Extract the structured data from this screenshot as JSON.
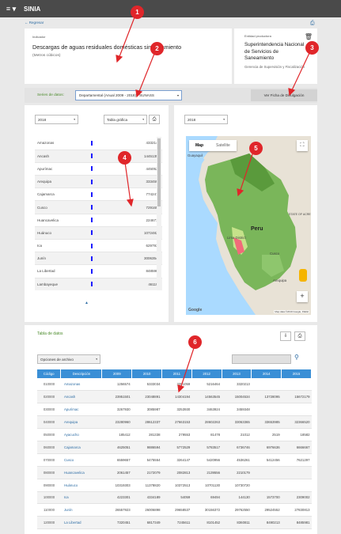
{
  "app": {
    "title": "SINIA",
    "menu_icon": "hamburger-icon"
  },
  "nav": {
    "back": "← Regresar"
  },
  "indicator": {
    "label": "Indicador",
    "title": "Descargas de aguas residuales domésticas sin tratamiento",
    "unit": "(Metros cúbicos)"
  },
  "entity": {
    "label": "Entidad productora",
    "name": "Superintendencia Nacional de Servicios de Saneamiento",
    "sub": "Gerencia de Supervisión y Fiscalización"
  },
  "series": {
    "label": "Series de datos:",
    "selected": "Departamental (Anual 2009 - 2018) - SUNASS",
    "ficha_button": "Ver Ficha de Divulgación"
  },
  "chart_panel": {
    "year": "2018",
    "view": "Tabla gráfica",
    "rows": [
      {
        "name": "Amazonas",
        "value": "4332143"
      },
      {
        "name": "Ancash",
        "value": "14451351"
      },
      {
        "name": "Apurímac",
        "value": "4450526"
      },
      {
        "name": "Arequipa",
        "value": "3334596"
      },
      {
        "name": "Cajamarca",
        "value": "7742474"
      },
      {
        "name": "Cusco",
        "value": "7291657"
      },
      {
        "name": "Huancavelica",
        "value": "2246713"
      },
      {
        "name": "Huánuco",
        "value": "10724820"
      },
      {
        "name": "Ica",
        "value": "6297930"
      },
      {
        "name": "Junín",
        "value": "30063548"
      },
      {
        "name": "La Libertad",
        "value": "8485981"
      },
      {
        "name": "Lambayeque",
        "value": "461193"
      }
    ]
  },
  "map_panel": {
    "year": "2018",
    "tab_map": "Map",
    "tab_satellite": "Satellite",
    "labels": {
      "guayaquil": "Guayaquil",
      "peru": "Peru",
      "lima": "Lima District",
      "acre": "STATE OF ACRE",
      "cusco": "Cusco",
      "arequipa": "Arequipa"
    },
    "google": "Google",
    "attribution": "Map data ©2019 Google, INEGI"
  },
  "data_table": {
    "title": "Tabla de datos",
    "options": "Opciones de archivo",
    "headers": [
      "Código",
      "Descripción",
      "2009",
      "2010",
      "2011",
      "2012",
      "2013",
      "2014",
      "2015"
    ],
    "rows": [
      [
        "010000",
        "Amazonas",
        "1256574",
        "5333034",
        "3391059",
        "5216464",
        "3320213",
        "",
        ""
      ],
      [
        "020000",
        "Ancash",
        "23951501",
        "23048891",
        "14304194",
        "14563545",
        "15004534",
        "13728095",
        "15672179"
      ],
      [
        "030000",
        "Apurímac",
        "3267930",
        "3085987",
        "3253930",
        "3463924",
        "3459348",
        "",
        ""
      ],
      [
        "040000",
        "Arequipa",
        "23280960",
        "28612337",
        "27663153",
        "28602263",
        "33063365",
        "33653985",
        "32366520"
      ],
      [
        "050000",
        "Ayacucho",
        "185412",
        "281338",
        "279553",
        "81478",
        "21012",
        "2519",
        "18582"
      ],
      [
        "060000",
        "Cajamarca",
        "4625051",
        "9886594",
        "5772529",
        "5783517",
        "6736746",
        "6976636",
        "6666667"
      ],
      [
        "070000",
        "Cusco",
        "6559657",
        "5475554",
        "3264147",
        "5420956",
        "4536261",
        "5412456",
        "7621297"
      ],
      [
        "080000",
        "Huancavelica",
        "2061457",
        "2172079",
        "2082813",
        "2139556",
        "2210179",
        "",
        ""
      ],
      [
        "090000",
        "Huánuco",
        "10319303",
        "11378820",
        "10372513",
        "10701130",
        "10730720",
        "",
        ""
      ],
      [
        "100000",
        "Ica",
        "4223301",
        "4334189",
        "54059",
        "69494",
        "144130",
        "1573700",
        "2309002"
      ],
      [
        "110000",
        "Junín",
        "26557923",
        "26006898",
        "29658537",
        "30156372",
        "29762550",
        "29524552",
        "27830813"
      ],
      [
        "120000",
        "La Libertad",
        "7320451",
        "6817349",
        "7245611",
        "8101452",
        "8360811",
        "8490213",
        "8485981"
      ]
    ]
  },
  "annotations": [
    "1",
    "2",
    "3",
    "4",
    "5",
    "6"
  ],
  "colors": {
    "accent": "#3a8fd6",
    "marker": "#e0262a",
    "map_green": "#6fae4b",
    "map_pink": "#f06b7a",
    "bar": "#1a1aff"
  }
}
